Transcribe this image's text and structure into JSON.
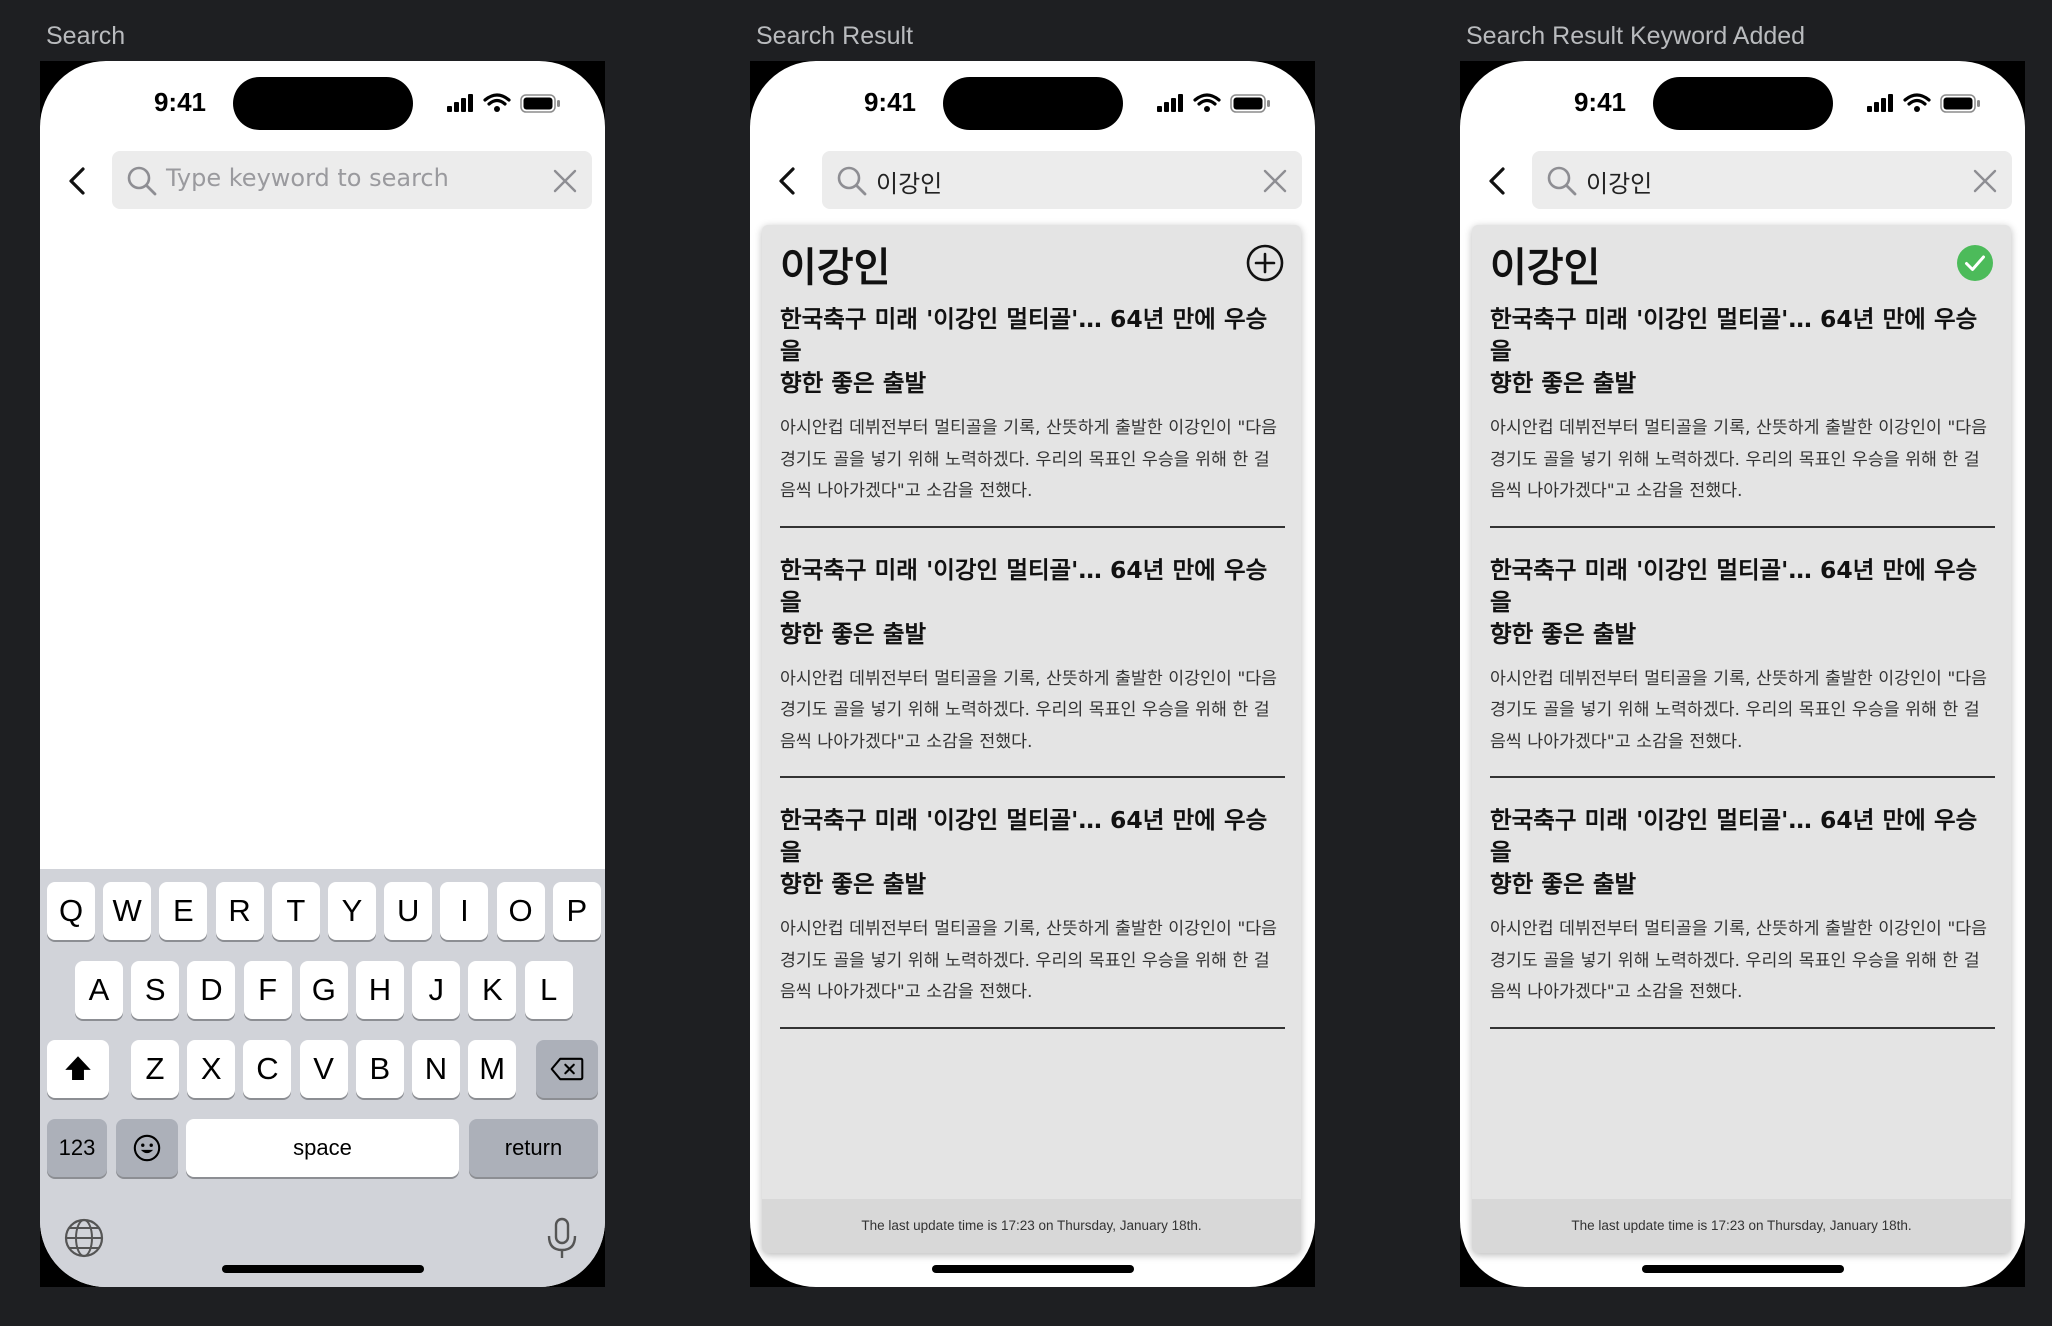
{
  "frames": [
    {
      "label": "Search",
      "time": "9:41",
      "search": {
        "value": "",
        "placeholder": "Type keyword to search"
      },
      "keyboard": {
        "row1": [
          "Q",
          "W",
          "E",
          "R",
          "T",
          "Y",
          "U",
          "I",
          "O",
          "P"
        ],
        "row2": [
          "A",
          "S",
          "D",
          "F",
          "G",
          "H",
          "J",
          "K",
          "L"
        ],
        "row3": [
          "Z",
          "X",
          "C",
          "V",
          "B",
          "N",
          "M"
        ],
        "numbers_label": "123",
        "space_label": "space",
        "return_label": "return"
      }
    },
    {
      "label": "Search Result",
      "time": "9:41",
      "search": {
        "value": "이강인"
      },
      "keyword": {
        "title": "이강인",
        "state": "add"
      },
      "footer": "The last update time is 17:23 on Thursday, January 18th."
    },
    {
      "label": "Search Result Keyword Added",
      "time": "9:41",
      "search": {
        "value": "이강인"
      },
      "keyword": {
        "title": "이강인",
        "state": "added"
      },
      "footer": "The last update time is 17:23 on Thursday, January 18th."
    }
  ],
  "articles": [
    {
      "title": "한국축구 미래 '이강인 멀티골'… 64년 만에 우승을\n향한 좋은 출발",
      "body": "아시안컵 데뷔전부터 멀티골을 기록, 산뜻하게 출발한 이강인이 \"다음\n경기도 골을 넣기 위해 노력하겠다. 우리의 목표인 우승을 위해 한 걸\n음씩 나아가겠다\"고 소감을 전했다."
    },
    {
      "title": "한국축구 미래 '이강인 멀티골'… 64년 만에 우승을\n향한 좋은 출발",
      "body": "아시안컵 데뷔전부터 멀티골을 기록, 산뜻하게 출발한 이강인이 \"다음\n경기도 골을 넣기 위해 노력하겠다. 우리의 목표인 우승을 위해 한 걸\n음씩 나아가겠다\"고 소감을 전했다."
    },
    {
      "title": "한국축구 미래 '이강인 멀티골'… 64년 만에 우승을\n향한 좋은 출발",
      "body": "아시안컵 데뷔전부터 멀티골을 기록, 산뜻하게 출발한 이강인이 \"다음\n경기도 골을 넣기 위해 노력하겠다. 우리의 목표인 우승을 위해 한 걸\n음씩 나아가겠다\"고 소감을 전했다."
    }
  ],
  "icons": {
    "back": "chevron-left-icon",
    "search": "search-icon",
    "clear": "close-icon",
    "add": "plus-circle-icon",
    "added": "check-circle-icon",
    "shift": "shift-icon",
    "delete": "backspace-icon",
    "emoji": "emoji-icon",
    "globe": "globe-icon",
    "mic": "microphone-icon"
  },
  "colors": {
    "page_bg": "#1e1f22",
    "label": "#b9bbbe",
    "card_bg": "#e4e4e4",
    "check_green": "#4cbb5a",
    "keyboard_bg": "#d1d3d9"
  }
}
